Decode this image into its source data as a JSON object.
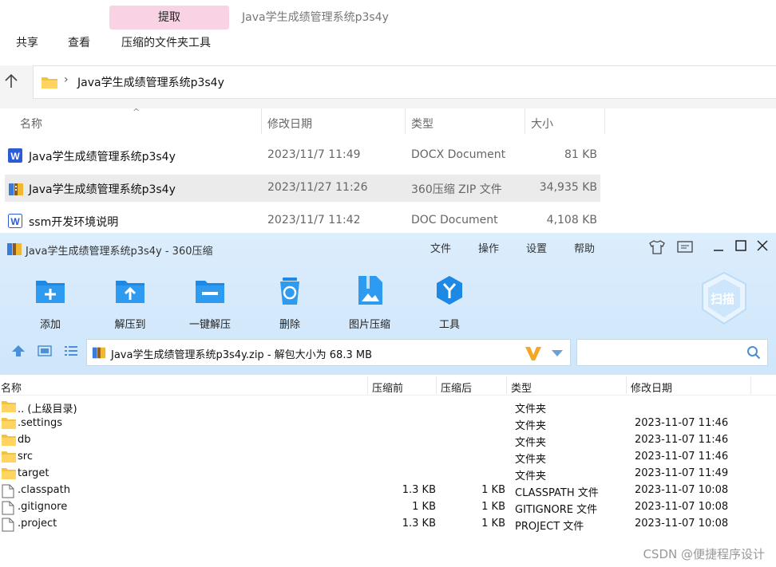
{
  "explorer": {
    "ribbon": {
      "extract_tab": "提取",
      "title": "Java学生成绩管理系统p3s4y",
      "menu": [
        "共享",
        "查看",
        "压缩的文件夹工具"
      ]
    },
    "address": {
      "path": "Java学生成绩管理系统p3s4y"
    },
    "columns": [
      "名称",
      "修改日期",
      "类型",
      "大小"
    ],
    "files": [
      {
        "name": "Java学生成绩管理系统p3s4y",
        "date": "2023/11/7 11:49",
        "type": "DOCX Document",
        "size": "81 KB",
        "icon": "word-docx-icon"
      },
      {
        "name": "Java学生成绩管理系统p3s4y",
        "date": "2023/11/27 11:26",
        "type": "360压缩 ZIP 文件",
        "size": "34,935 KB",
        "icon": "zip-archive-icon"
      },
      {
        "name": "ssm开发环境说明",
        "date": "2023/11/7 11:42",
        "type": "DOC Document",
        "size": "4,108 KB",
        "icon": "word-doc-icon"
      }
    ]
  },
  "zip": {
    "title": "Java学生成绩管理系统p3s4y - 360压缩",
    "menu": [
      "文件",
      "操作",
      "设置",
      "帮助"
    ],
    "tools": [
      {
        "label": "添加",
        "icon": "add-icon"
      },
      {
        "label": "解压到",
        "icon": "extract-to-icon"
      },
      {
        "label": "一键解压",
        "icon": "one-click-extract-icon"
      },
      {
        "label": "删除",
        "icon": "delete-icon"
      },
      {
        "label": "图片压缩",
        "icon": "image-compress-icon"
      },
      {
        "label": "工具",
        "icon": "tools-icon"
      }
    ],
    "scan_label": "扫描",
    "address": "Java学生成绩管理系统p3s4y.zip - 解包大小为 68.3 MB",
    "columns": [
      "名称",
      "压缩前",
      "压缩后",
      "类型",
      "修改日期"
    ],
    "entries": [
      {
        "name": ".. (上级目录)",
        "before": "",
        "after": "",
        "type": "文件夹",
        "date": "",
        "kind": "folder"
      },
      {
        "name": ".settings",
        "before": "",
        "after": "",
        "type": "文件夹",
        "date": "2023-11-07 11:46",
        "kind": "folder"
      },
      {
        "name": "db",
        "before": "",
        "after": "",
        "type": "文件夹",
        "date": "2023-11-07 11:46",
        "kind": "folder"
      },
      {
        "name": "src",
        "before": "",
        "after": "",
        "type": "文件夹",
        "date": "2023-11-07 11:46",
        "kind": "folder"
      },
      {
        "name": "target",
        "before": "",
        "after": "",
        "type": "文件夹",
        "date": "2023-11-07 11:49",
        "kind": "folder"
      },
      {
        "name": ".classpath",
        "before": "1.3 KB",
        "after": "1 KB",
        "type": "CLASSPATH 文件",
        "date": "2023-11-07 10:08",
        "kind": "file"
      },
      {
        "name": ".gitignore",
        "before": "1 KB",
        "after": "1 KB",
        "type": "GITIGNORE 文件",
        "date": "2023-11-07 10:08",
        "kind": "file"
      },
      {
        "name": ".project",
        "before": "1.3 KB",
        "after": "1 KB",
        "type": "PROJECT 文件",
        "date": "2023-11-07 10:08",
        "kind": "file"
      }
    ]
  },
  "watermark": "CSDN @便捷程序设计",
  "colors": {
    "accent_blue": "#2d8ee6",
    "chrome_blue": "#d6eafc",
    "selected_row": "#ebebeb",
    "extract_tab": "#f9d2e4"
  }
}
